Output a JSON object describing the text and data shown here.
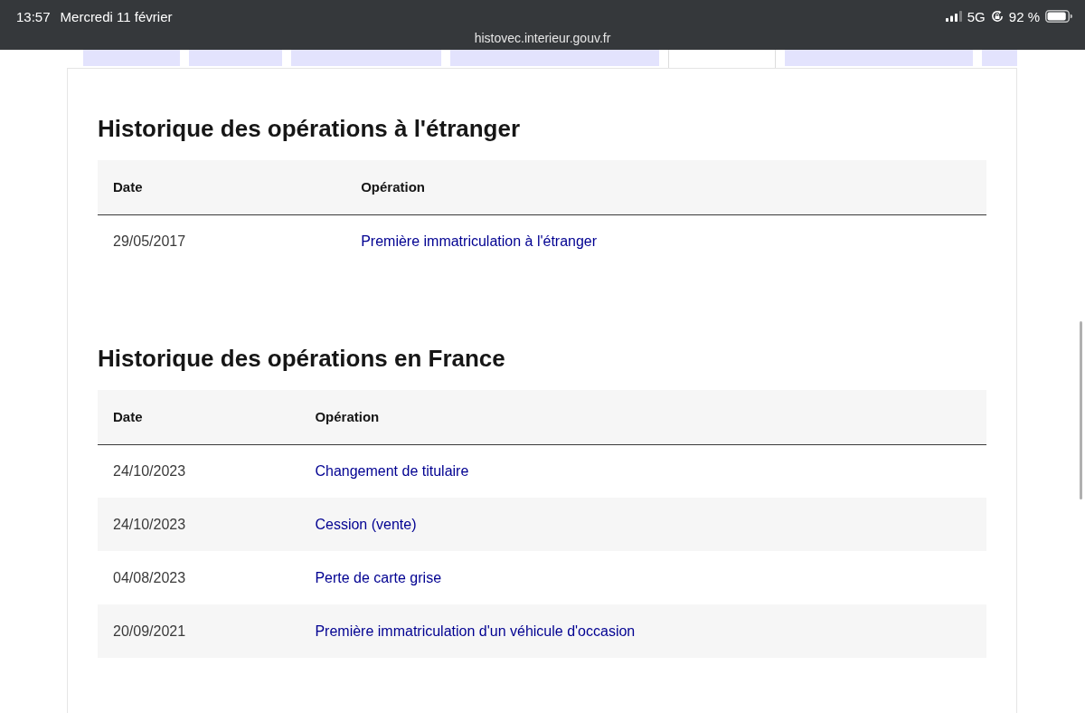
{
  "status_bar": {
    "time": "13:57",
    "date": "Mercredi 11 février",
    "network": "5G",
    "battery": "92 %",
    "url": "histovec.interieur.gouv.fr"
  },
  "tabs": [
    {
      "selected": false
    },
    {
      "selected": false
    },
    {
      "selected": false
    },
    {
      "selected": false
    },
    {
      "selected": true
    },
    {
      "selected": false
    },
    {
      "selected": false
    }
  ],
  "sections": [
    {
      "title": "Historique des opérations à l'étranger",
      "columns": [
        "Date",
        "Opération"
      ],
      "rows": [
        {
          "date": "29/05/2017",
          "operation": "Première immatriculation à l'étranger"
        }
      ]
    },
    {
      "title": "Historique des opérations en France",
      "columns": [
        "Date",
        "Opération"
      ],
      "rows": [
        {
          "date": "24/10/2023",
          "operation": "Changement de titulaire"
        },
        {
          "date": "24/10/2023",
          "operation": "Cession (vente)"
        },
        {
          "date": "04/08/2023",
          "operation": "Perte de carte grise"
        },
        {
          "date": "20/09/2021",
          "operation": "Première immatriculation d'un véhicule d'occasion"
        }
      ]
    }
  ]
}
